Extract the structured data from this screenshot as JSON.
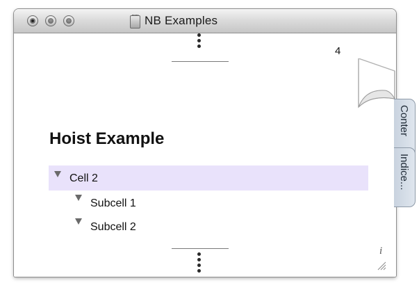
{
  "window": {
    "title": "NB Examples",
    "controls": [
      "close",
      "minimize",
      "zoom"
    ]
  },
  "page": {
    "page_number": "4",
    "heading": "Hoist Example",
    "cells": [
      {
        "label": "Cell 2",
        "level": 0,
        "expanded": true,
        "selected": true
      },
      {
        "label": "Subcell 1",
        "level": 1,
        "expanded": true,
        "selected": false
      },
      {
        "label": "Subcell 2",
        "level": 1,
        "expanded": true,
        "selected": false
      }
    ],
    "info_label": "i"
  },
  "side_tabs": [
    {
      "label": "Conter"
    },
    {
      "label": "Indice..."
    }
  ],
  "colors": {
    "selection": "#e9e2fb",
    "titlebar": "#dcdcdc"
  }
}
